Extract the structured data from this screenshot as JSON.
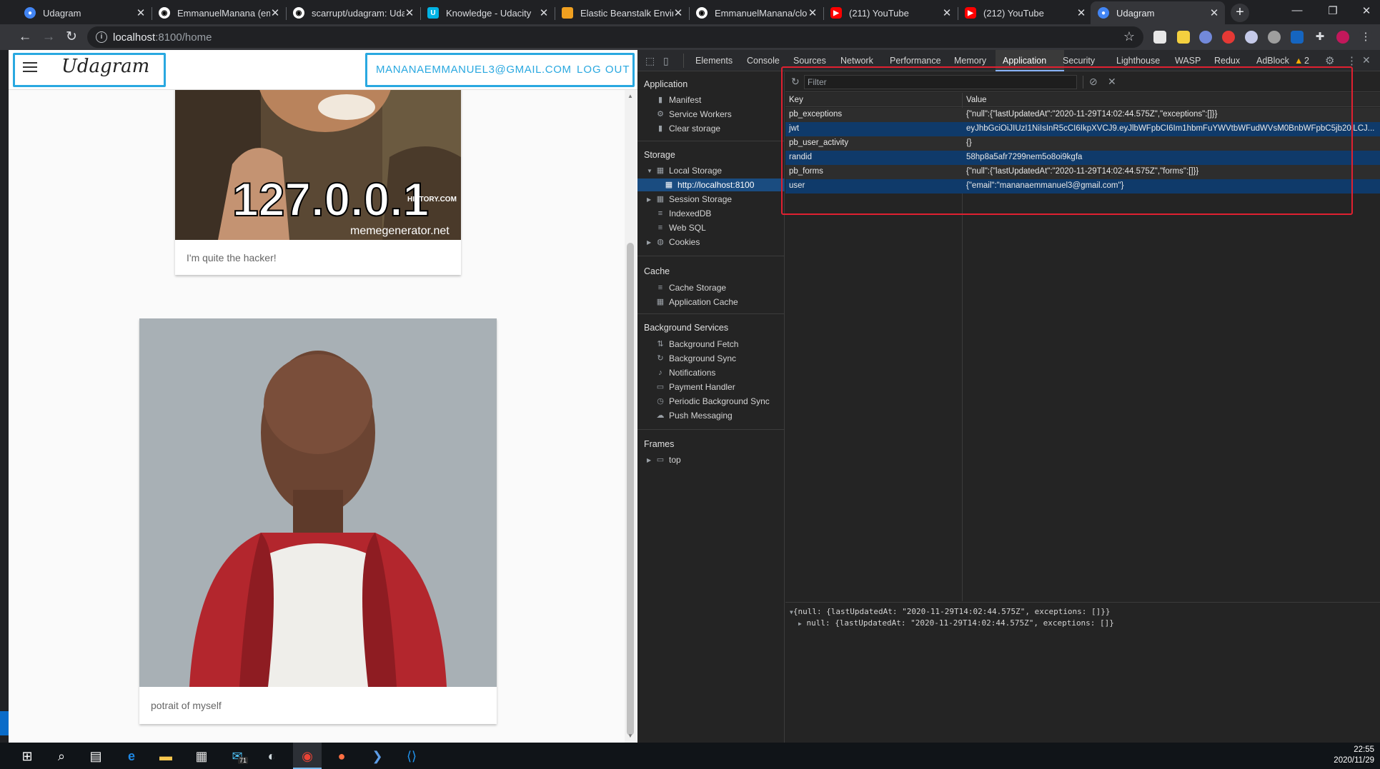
{
  "browser": {
    "tabs": [
      {
        "title": "Udagram",
        "icon": "udagram-favicon",
        "color": "#4285f4"
      },
      {
        "title": "EmmanuelManana (em",
        "icon": "github-icon",
        "color": "#ffffff"
      },
      {
        "title": "scarrupt/udagram: Uda",
        "icon": "github-icon",
        "color": "#ffffff"
      },
      {
        "title": "Knowledge - Udacity",
        "icon": "udacity-icon",
        "color": "#02b3e4"
      },
      {
        "title": "Elastic Beanstalk Enviro",
        "icon": "aws-icon",
        "color": "#f0a020"
      },
      {
        "title": "EmmanuelManana/clo",
        "icon": "github-icon",
        "color": "#ffffff"
      },
      {
        "title": "(211) YouTube",
        "icon": "youtube-icon",
        "color": "#ff0000"
      },
      {
        "title": "(212) YouTube",
        "icon": "youtube-icon",
        "color": "#ff0000"
      },
      {
        "title": "Udagram",
        "icon": "udagram-favicon",
        "color": "#4285f4",
        "active": true
      }
    ],
    "url_host": "localhost",
    "url_path": ":8100/home"
  },
  "app": {
    "title": "Udagram",
    "user_email": "MANANAEMMANUEL3@GMAIL.COM",
    "logout_label": "LOG OUT",
    "highlight_color": "#29a8e0",
    "feed": [
      {
        "image_text": "127.0.0.1",
        "image_subtext": "memegenerator.net",
        "image_badge": "HISTORY.COM",
        "caption": "I'm quite the hacker!"
      },
      {
        "image_text": "",
        "caption": "potrait of myself"
      }
    ]
  },
  "devtools": {
    "tabs": [
      "Elements",
      "Console",
      "Sources",
      "Network",
      "Performance",
      "Memory",
      "Application",
      "Security",
      "Lighthouse",
      "WASP",
      "Redux",
      "AdBlock"
    ],
    "active_tab": "Application",
    "warning_count": "2",
    "sidebar": {
      "application_head": "Application",
      "application_items": [
        "Manifest",
        "Service Workers",
        "Clear storage"
      ],
      "storage_head": "Storage",
      "storage_items": [
        "Local Storage",
        "http://localhost:8100",
        "Session Storage",
        "IndexedDB",
        "Web SQL",
        "Cookies"
      ],
      "cache_head": "Cache",
      "cache_items": [
        "Cache Storage",
        "Application Cache"
      ],
      "background_head": "Background Services",
      "background_items": [
        "Background Fetch",
        "Background Sync",
        "Notifications",
        "Payment Handler",
        "Periodic Background Sync",
        "Push Messaging"
      ],
      "frames_head": "Frames",
      "frames_items": [
        "top"
      ]
    },
    "filter_placeholder": "Filter",
    "columns": {
      "key": "Key",
      "value": "Value"
    },
    "rows": [
      {
        "key": "pb_exceptions",
        "value": "{\"null\":{\"lastUpdatedAt\":\"2020-11-29T14:02:44.575Z\",\"exceptions\":[]}}"
      },
      {
        "key": "jwt",
        "value": "eyJhbGciOiJIUzI1NiIsInR5cCI6IkpXVCJ9.eyJlbWFpbCI6Im1hbmFuYWVtbWFudWVsM0BnbWFpbC5jb20iLCJ..."
      },
      {
        "key": "pb_user_activity",
        "value": "{}"
      },
      {
        "key": "randid",
        "value": "58hp8a5afr7299nem5o8oi9kgfa"
      },
      {
        "key": "pb_forms",
        "value": "{\"null\":{\"lastUpdatedAt\":\"2020-11-29T14:02:44.575Z\",\"forms\":[]}}"
      },
      {
        "key": "user",
        "value": "{\"email\":\"mananaemmanuel3@gmail.com\"}"
      }
    ],
    "preview_line1": "{null: {lastUpdatedAt: \"2020-11-29T14:02:44.575Z\", exceptions: []}}",
    "preview_line2": "null: {lastUpdatedAt: \"2020-11-29T14:02:44.575Z\", exceptions: []}"
  },
  "taskbar": {
    "mail_badge": "71",
    "time": "22:55",
    "date": "2020/11/29"
  }
}
